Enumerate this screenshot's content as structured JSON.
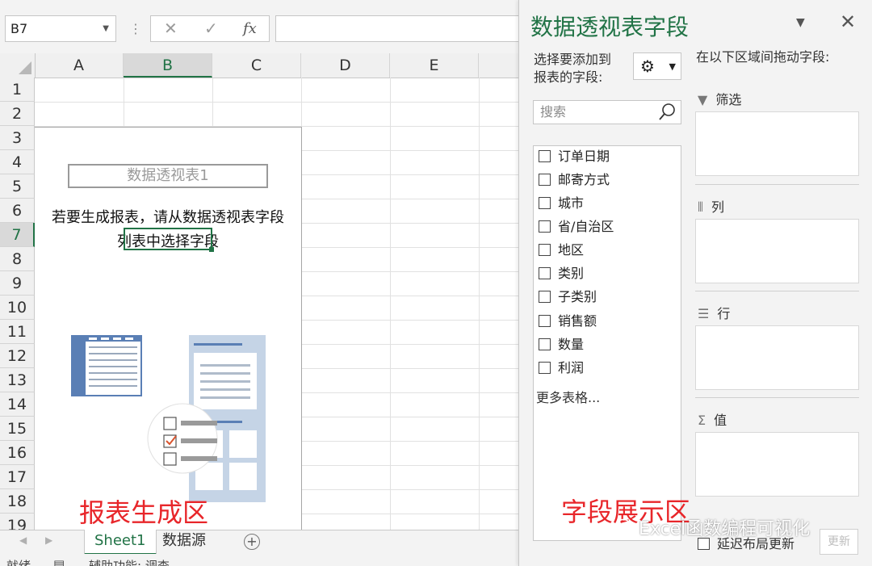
{
  "formula_bar": {
    "name_box": "B7",
    "cancel_icon": "✕",
    "enter_icon": "✓",
    "fx_label": "fx",
    "formula_value": ""
  },
  "grid": {
    "columns": [
      "A",
      "B",
      "C",
      "D",
      "E"
    ],
    "selected_column": "B",
    "rows": [
      "1",
      "2",
      "3",
      "4",
      "5",
      "6",
      "7",
      "8",
      "9",
      "10",
      "11",
      "12",
      "13",
      "14",
      "15",
      "16",
      "17",
      "18",
      "19"
    ],
    "selected_row": "7",
    "pivot_name": "数据透视表1",
    "pivot_message_line1": "若要生成报表，请从数据透视表字段",
    "pivot_message_line2": "列表中选择字段",
    "report_area_caption": "报表生成区"
  },
  "sheet_tabs": {
    "tabs": [
      "Sheet1",
      "数据源"
    ],
    "active": "Sheet1"
  },
  "status_bar": {
    "ready": "就绪",
    "accessibility": "辅助功能: 调查"
  },
  "pivot_pane": {
    "title": "数据透视表字段",
    "choose_label_line1": "选择要添加到",
    "choose_label_line2": "报表的字段:",
    "drag_label": "在以下区域间拖动字段:",
    "search_placeholder": "搜索",
    "fields": [
      "订单日期",
      "邮寄方式",
      "城市",
      "省/自治区",
      "地区",
      "类别",
      "子类别",
      "销售额",
      "数量",
      "利润"
    ],
    "more_tables": "更多表格...",
    "zones": {
      "filter": "筛选",
      "columns": "列",
      "rows": "行",
      "values": "值"
    },
    "defer_update": "延迟布局更新",
    "update_button": "更新",
    "field_area_caption": "字段展示区",
    "watermark": "Excel函数编程可视化"
  },
  "colors": {
    "excel_green": "#217346",
    "caption_red": "#e8262a",
    "illustration_blue": "#5a7fb5"
  }
}
